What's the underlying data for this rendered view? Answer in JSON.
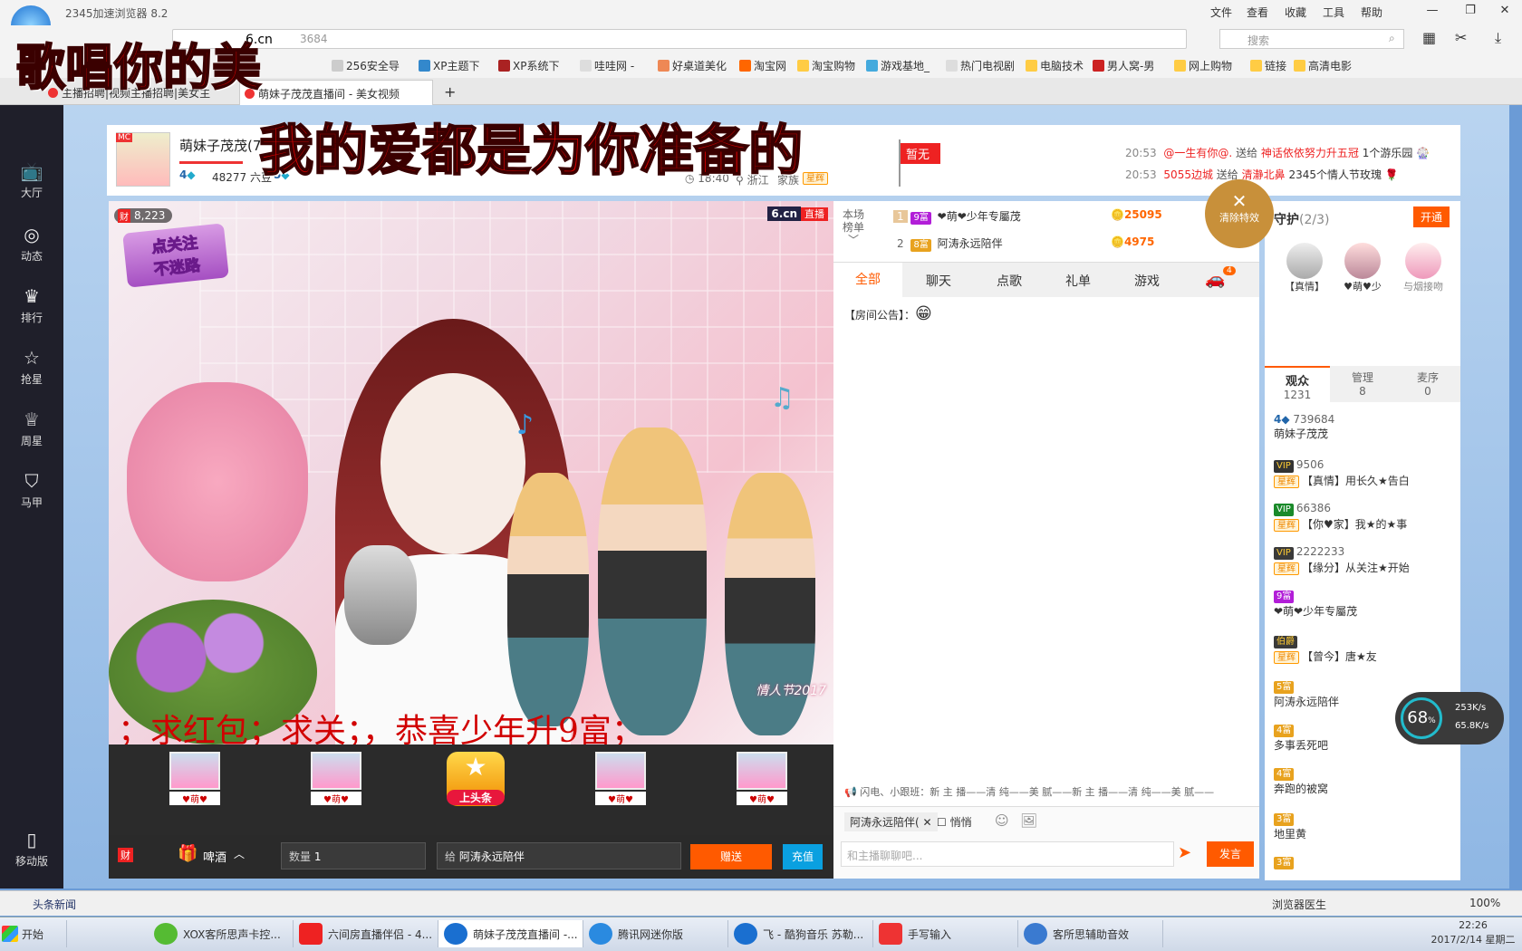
{
  "browser": {
    "title": "2345加速浏览器 8.2",
    "menu": [
      "文件",
      "查看",
      "收藏",
      "工具",
      "帮助"
    ],
    "address_fragment": "6.cn",
    "address_rest": "3684",
    "search_placeholder": "搜索",
    "bookmarks": [
      "256安全导",
      "XP主题下",
      "XP系统下",
      "哇哇网 -",
      "好桌道美化",
      "淘宝网",
      "淘宝购物",
      "游戏基地_",
      "热门电视剧",
      "电脑技术",
      "男人窝-男",
      "网上购物",
      "链接",
      "高清电影"
    ],
    "tabs": [
      "主播招聘|视频主播招聘|美女主",
      "萌妹子茂茂直播间 - 美女视频"
    ],
    "new_tab": "+"
  },
  "lyrics": {
    "line1": "歌唱你的美",
    "line2": "我的爱都是为你准备的"
  },
  "site_nav": [
    "大厅",
    "动态",
    "排行",
    "抢星",
    "周星",
    "马甲"
  ],
  "site_nav_icons": [
    "tv-icon",
    "compass-icon",
    "crown-icon",
    "star-icon",
    "cup-icon",
    "shirt-icon"
  ],
  "header": {
    "anchor_name": "萌妹子茂茂(7",
    "level": "4",
    "beans": "48277 六豆",
    "fans_level": "5",
    "time": "18:40",
    "location": "浙江",
    "family_label": "家族",
    "family_badge": "星辉",
    "stage_flag": "暂无",
    "mc_badge": "MC",
    "notices": [
      {
        "time": "20:53",
        "from": "@一生有你@.",
        "verb": "送给",
        "to": "神话依依努力升五冠",
        "gift": "1个游乐园"
      },
      {
        "time": "20:53",
        "from": "5055边城",
        "verb": "送给",
        "to": "清瀞北鼻",
        "gift": "2345个情人节玫瑰"
      }
    ]
  },
  "video": {
    "viewers": "8,223",
    "logo": "6.cn",
    "live": "直播",
    "follow_line1": "点关注",
    "follow_line2": "不迷路",
    "marquee": "；求红包；求关；，恭喜少年升9富；",
    "watermark": "情人节2017"
  },
  "gifts": {
    "slots": [
      "♥萌♥",
      "♥萌♥",
      "上头条",
      "♥萌♥",
      "♥萌♥"
    ],
    "gift_name": "啤酒",
    "quantity_label": "数量",
    "quantity": "1",
    "to_label": "给",
    "to_user": "阿涛永远陪伴",
    "send": "赠送",
    "recharge": "充值"
  },
  "ranking": {
    "label1": "本场",
    "label2": "榜单",
    "rows": [
      {
        "rank": "1",
        "badge": "9富",
        "name": "❤萌❤少年专屬茂",
        "coins": "25095"
      },
      {
        "rank": "2",
        "badge": "8富",
        "name": "阿涛永远陪伴",
        "coins": "4975"
      }
    ]
  },
  "clear_effects": "清除特效",
  "chat": {
    "tabs": [
      "全部",
      "聊天",
      "点歌",
      "礼单",
      "游戏"
    ],
    "car_count": "4",
    "announcement": "【房间公告】：",
    "ticker": "闪电、小跟班：新 主 播——清 纯——美 腻——新 主 播——清 纯——美 腻——",
    "to_user": "阿涛永远陪伴(",
    "whisper": "悄悄",
    "placeholder": "和主播聊聊吧...",
    "send": "发言"
  },
  "guard": {
    "title": "守护",
    "count": "(2/3)",
    "open": "开通",
    "members": [
      "【真情】",
      "♥萌♥少",
      "与烟接吻"
    ]
  },
  "audience_tabs": [
    {
      "label": "观众",
      "count": "1231"
    },
    {
      "label": "管理",
      "count": "8"
    },
    {
      "label": "麦序",
      "count": "0"
    }
  ],
  "audience": [
    {
      "level": "4",
      "id": "739684",
      "name": "萌妹子茂茂",
      "badge": ""
    },
    {
      "level": "",
      "id": "9506",
      "name": "【真情】用长久★告白",
      "badge": "星辉"
    },
    {
      "level": "",
      "id": "66386",
      "name": "【你♥家】我★的★事",
      "badge": "星辉"
    },
    {
      "level": "",
      "id": "2222233",
      "name": "【缘分】从关注★开始",
      "badge": "星辉"
    },
    {
      "level": "9富",
      "id": "",
      "name": "❤萌❤少年专屬茂",
      "badge": ""
    },
    {
      "level": "伯爵",
      "id": "",
      "name": "【曾今】唐★友",
      "badge": "星辉"
    },
    {
      "level": "5富",
      "id": "",
      "name": "阿涛永远陪伴",
      "badge": ""
    },
    {
      "level": "4富",
      "id": "",
      "name": "多事丢死吧",
      "badge": ""
    },
    {
      "level": "4富",
      "id": "",
      "name": "奔跑的被窝",
      "badge": ""
    },
    {
      "level": "3富",
      "id": "",
      "name": "地里黄",
      "badge": ""
    },
    {
      "level": "3富",
      "id": "",
      "name": "",
      "badge": ""
    }
  ],
  "network": {
    "percent": "68",
    "up": "253K/s",
    "down": "65.8K/s"
  },
  "mobile": "移动版",
  "statusbar": {
    "news": "头条新闻",
    "doctor": "浏览器医生",
    "zoom": "100%"
  },
  "taskbar": {
    "start": "开始",
    "items": [
      "XOX客所思声卡控...",
      "六间房直播伴侣 - 4...",
      "萌妹子茂茂直播间 -...",
      "腾讯网迷你版",
      "飞 - 酷狗音乐 苏勒...",
      "手写输入",
      "客所思辅助音效"
    ],
    "time": "22:26",
    "date": "2017/2/14 星期二"
  },
  "colors": {
    "accent": "#ff5a00",
    "chat_tab": "#ff5a00",
    "nav_bg": "#1f1f2a"
  }
}
